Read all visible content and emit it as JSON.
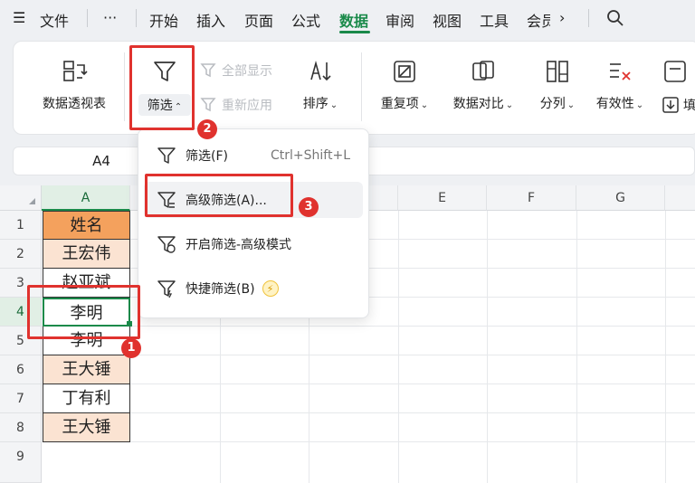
{
  "menubar": {
    "items": [
      {
        "label": "文件"
      },
      {
        "label": "开始"
      },
      {
        "label": "插入"
      },
      {
        "label": "页面"
      },
      {
        "label": "公式"
      },
      {
        "label": "数据"
      },
      {
        "label": "审阅"
      },
      {
        "label": "视图"
      },
      {
        "label": "工具"
      },
      {
        "label": "会员"
      }
    ],
    "more_label": "···",
    "active": "数据"
  },
  "ribbon": {
    "pivot": "数据透视表",
    "filter": "筛选",
    "show_all": "全部显示",
    "reapply": "重新应用",
    "sort": "排序",
    "duplicates": "重复项",
    "compare": "数据对比",
    "split": "分列",
    "validity": "有效性",
    "fill": "填"
  },
  "namebox": {
    "value": "A4"
  },
  "grid": {
    "columns": [
      "A",
      "B",
      "C",
      "D",
      "E",
      "F",
      "G"
    ],
    "rows": [
      "1",
      "2",
      "3",
      "4",
      "5",
      "6",
      "7",
      "8",
      "9"
    ],
    "cells": [
      "姓名",
      "王宏伟",
      "赵亚斌",
      "李明",
      "李明",
      "王大锤",
      "丁有利",
      "王大锤"
    ]
  },
  "dropdown": {
    "items": [
      {
        "label": "筛选(F)",
        "shortcut": "Ctrl+Shift+L"
      },
      {
        "label": "高级筛选(A)..."
      },
      {
        "label": "开启筛选-高级模式"
      },
      {
        "label": "快捷筛选(B)"
      }
    ]
  },
  "annotations": [
    "1",
    "2",
    "3"
  ],
  "colors": {
    "accent": "#1a8a4a",
    "header_fill": "#f4a15d",
    "highlight_fill": "#fbe3d2",
    "marker": "#e0322e"
  }
}
